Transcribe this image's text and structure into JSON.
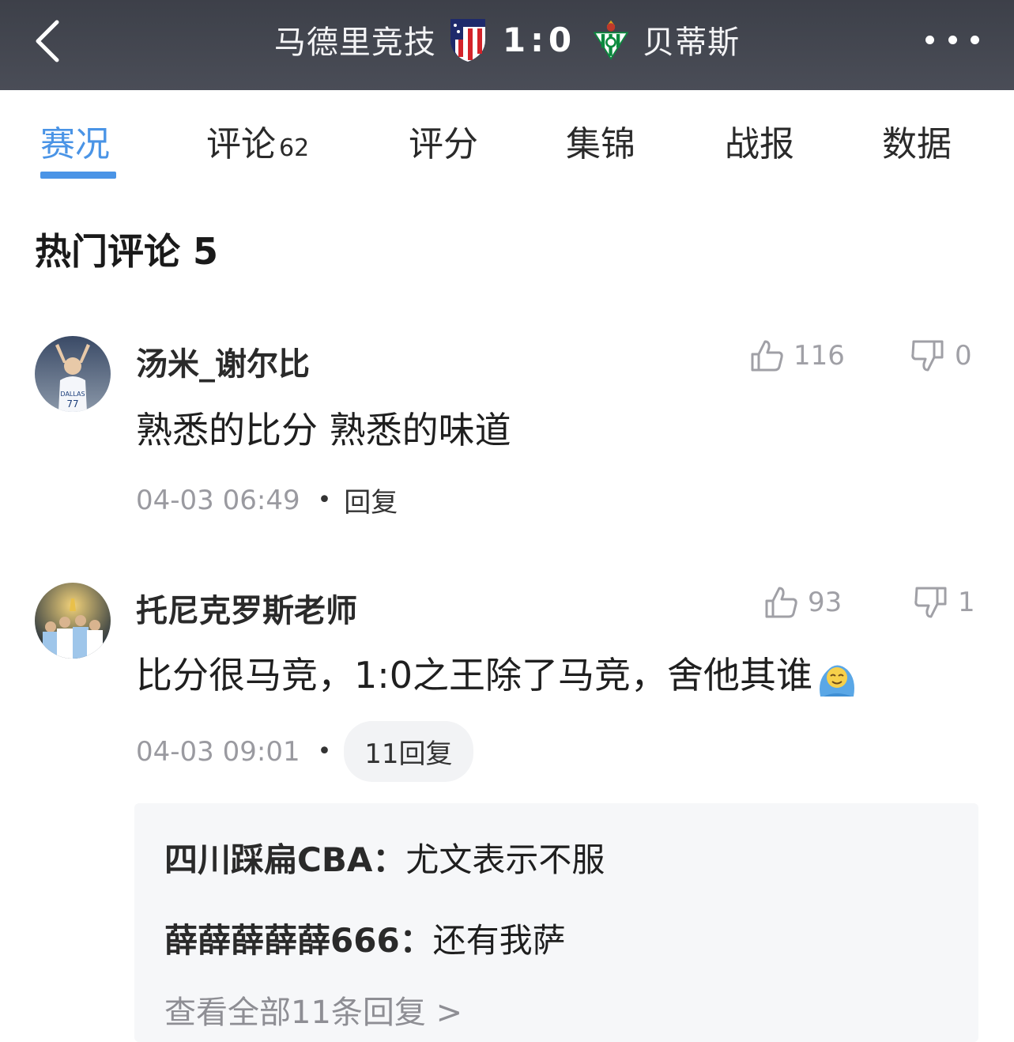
{
  "header": {
    "home_team": "马德里竞技",
    "score": "1:0",
    "away_team": "贝蒂斯",
    "icons": {
      "back": "chevron-left-icon",
      "more": "more-dots-icon"
    }
  },
  "tabs": [
    {
      "label": "赛况",
      "count": "",
      "active": true
    },
    {
      "label": "评论",
      "count": "62",
      "active": false
    },
    {
      "label": "评分",
      "count": "",
      "active": false
    },
    {
      "label": "集锦",
      "count": "",
      "active": false
    },
    {
      "label": "战报",
      "count": "",
      "active": false
    },
    {
      "label": "数据",
      "count": "",
      "active": false
    }
  ],
  "section": {
    "title": "热门评论 5"
  },
  "comments": [
    {
      "username": "汤米_谢尔比",
      "likes": "116",
      "dislikes": "0",
      "text": "熟悉的比分 熟悉的味道",
      "time": "04-03 06:49",
      "reply_label": "回复"
    },
    {
      "username": "托尼克罗斯老师",
      "likes": "93",
      "dislikes": "1",
      "text": "比分很马竞，1:0之王除了马竞，舍他其谁",
      "time": "04-03 09:01",
      "reply_label": "11回复",
      "replies": [
        {
          "name": "四川踩扁CBA：",
          "text": "尤文表示不服"
        },
        {
          "name": "薛薛薛薛薛666：",
          "text": "还有我萨"
        }
      ],
      "view_all": "查看全部11条回复 >"
    }
  ],
  "colors": {
    "accent": "#4a94e6",
    "header_bg": "#43464f",
    "muted": "#9a9aa0"
  }
}
